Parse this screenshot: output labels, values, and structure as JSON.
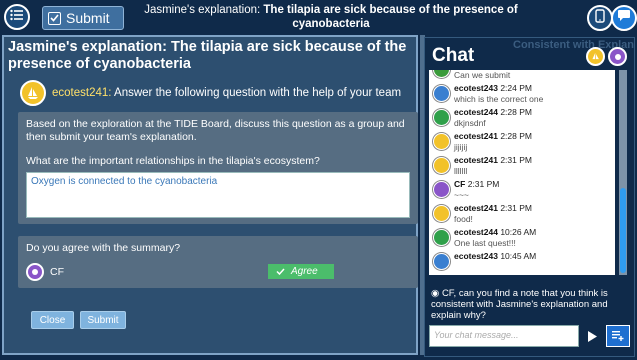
{
  "topbar": {
    "submit_label": "Submit",
    "title_prefix": "Jasmine's explanation:",
    "title_bold": "The tilapia are sick because of the presence of cyanobacteria",
    "icons": [
      "menu-icon",
      "checkbox-icon",
      "tablet-icon",
      "chat-bubble-icon"
    ]
  },
  "left": {
    "title": "Jasmine's explanation: The tilapia are sick because of the presence of cyanobacteria",
    "prompt": {
      "username": "ecotest241:",
      "text": "Answer the following question with the help of your team"
    },
    "question": {
      "intro": "Based on the exploration at the TIDE Board, discuss this question as a group and then submit your team's explanation.",
      "ask": "What are the important relationships in the tilapia's ecosystem?",
      "answer": "Oxygen is connected to the cyanobacteria"
    },
    "agreement": {
      "question": "Do you agree with the summary?",
      "member": "CF",
      "status": "Agree"
    },
    "close_label": "Close",
    "submit_label": "Submit"
  },
  "chat": {
    "title": "Chat",
    "ghost_text": "Consistent with Explan",
    "messages": [
      {
        "user": "",
        "time": "",
        "text": "Can we submit",
        "color": "#3a9a3a"
      },
      {
        "user": "ecotest243",
        "time": "2:24 PM",
        "text": "which is the correct one",
        "color": "#3a7fd0"
      },
      {
        "user": "ecotest244",
        "time": "2:28 PM",
        "text": "dkjnsdnf",
        "color": "#2fa04a"
      },
      {
        "user": "ecotest241",
        "time": "2:28 PM",
        "text": "jijijij",
        "color": "#f2c22a"
      },
      {
        "user": "ecotest241",
        "time": "2:31 PM",
        "text": "lllllll",
        "color": "#f2c22a"
      },
      {
        "user": "CF",
        "time": "2:31 PM",
        "text": "~~~",
        "color": "#8a55c8"
      },
      {
        "user": "ecotest241",
        "time": "2:31 PM",
        "text": "food!",
        "color": "#f2c22a"
      },
      {
        "user": "ecotest244",
        "time": "10:26 AM",
        "text": "One last quest!!!",
        "color": "#2fa04a"
      },
      {
        "user": "ecotest243",
        "time": "10:45 AM",
        "text": "",
        "color": "#3a7fd0"
      }
    ],
    "prompt": "CF, can you find a note that you think is consistent with Jasmine's explanation and explain why?",
    "input_placeholder": "Your chat message..."
  }
}
